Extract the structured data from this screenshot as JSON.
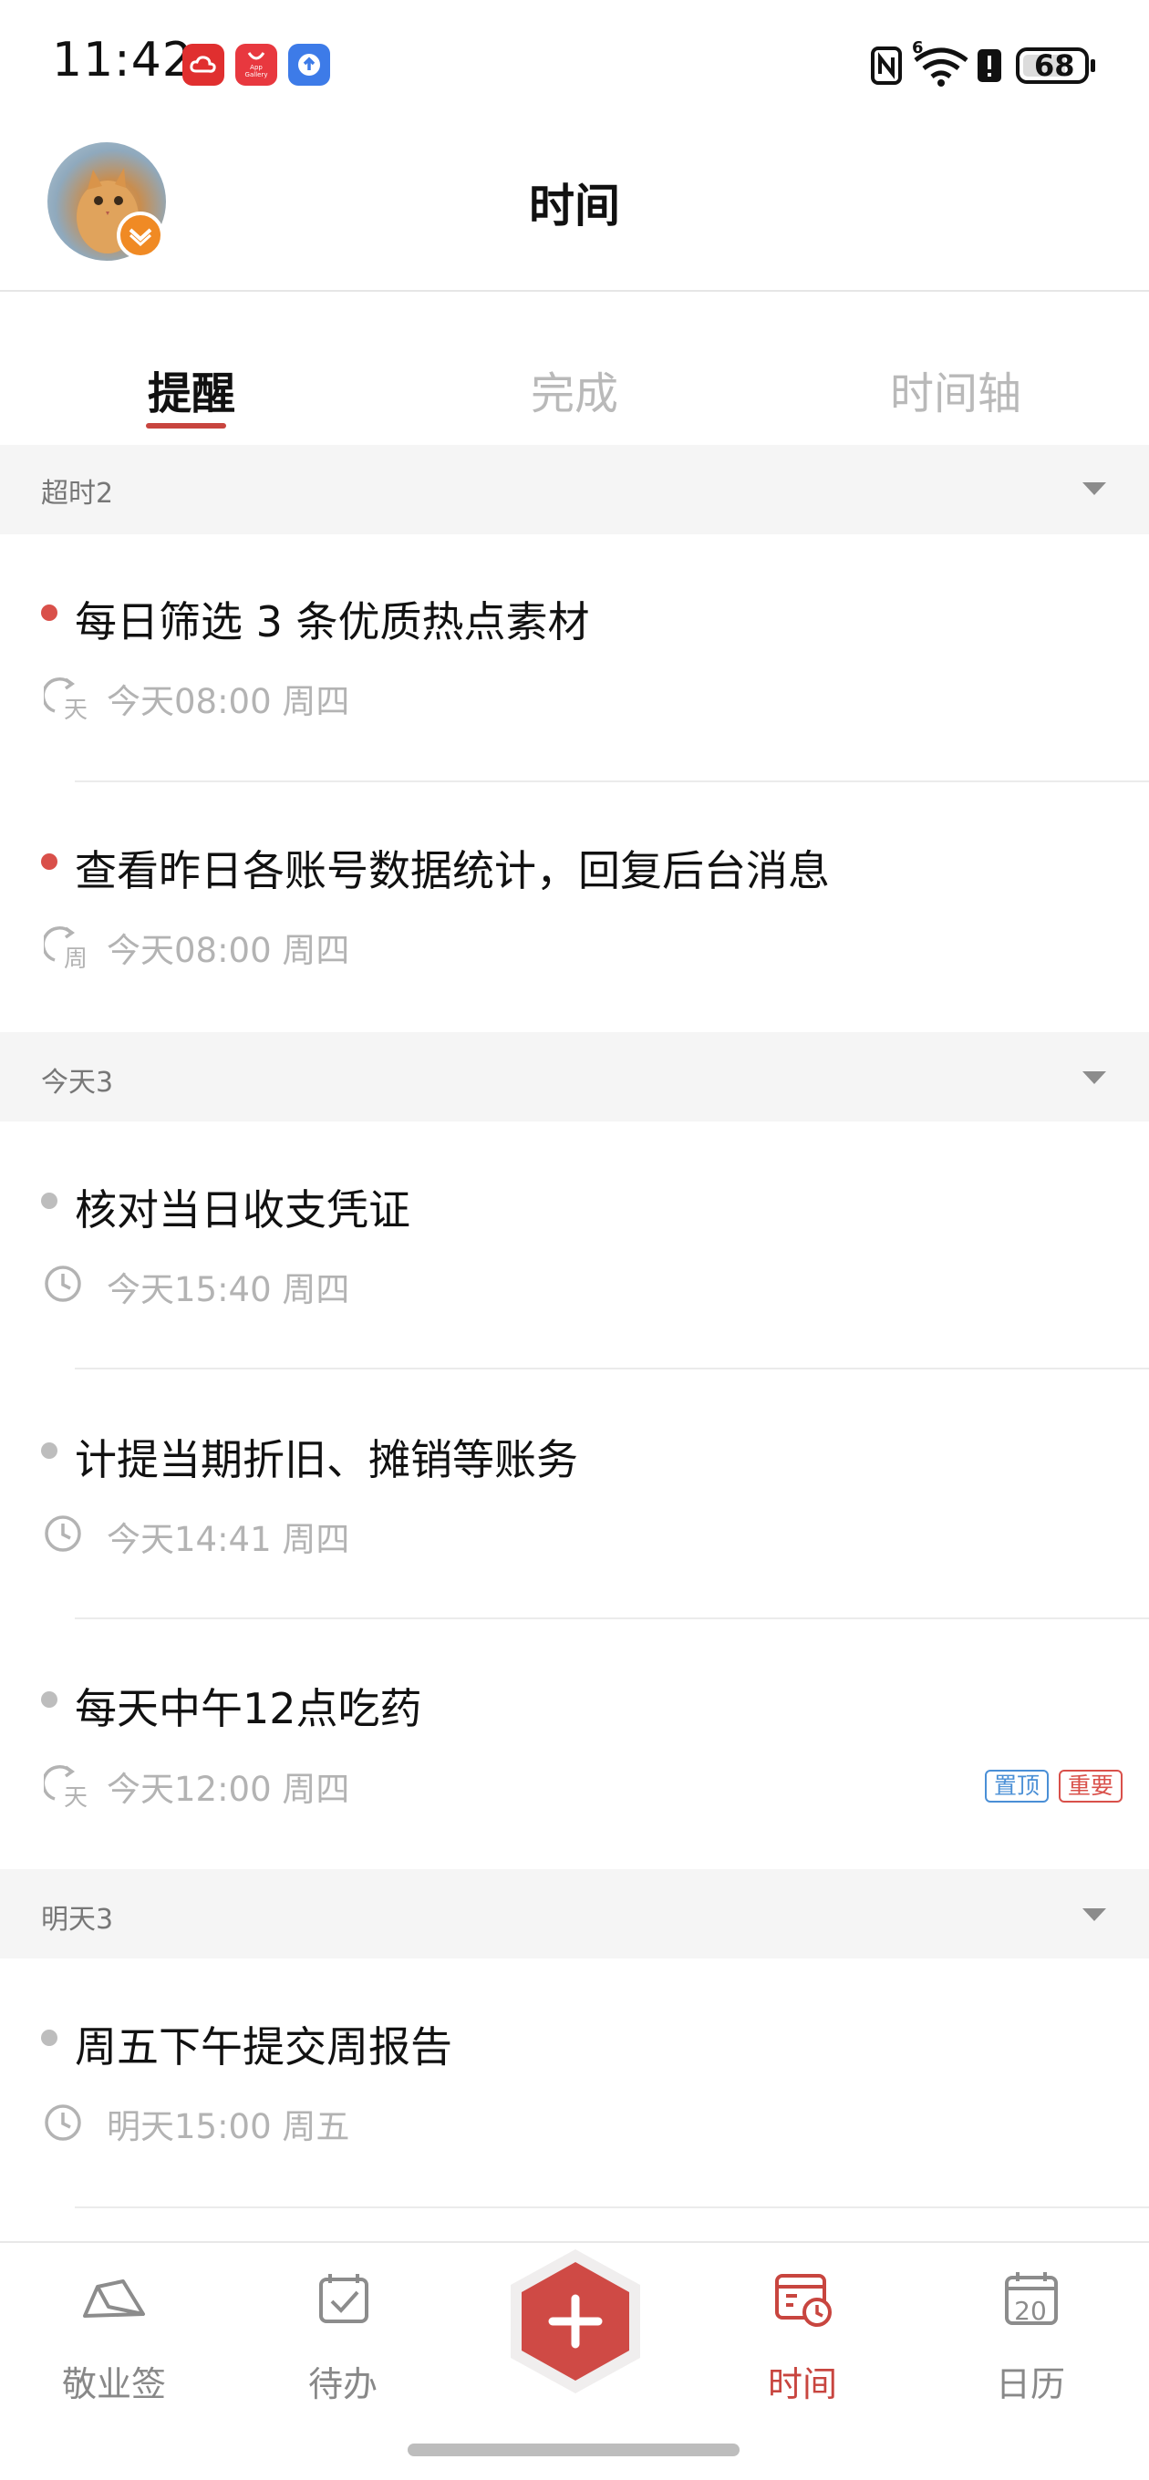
{
  "status_bar": {
    "time": "11:42",
    "app_icons": [
      "cloud-app-icon",
      "app-gallery-icon",
      "upload-app-icon"
    ],
    "app_gallery_label": "App Gallery",
    "system_icons": [
      "nfc-icon",
      "wifi-icon",
      "alert-icon",
      "battery-icon"
    ],
    "wifi_generation": "6",
    "battery_level": "68"
  },
  "header": {
    "title": "时间"
  },
  "tabs": [
    {
      "label": "提醒",
      "active": true
    },
    {
      "label": "完成",
      "active": false
    },
    {
      "label": "时间轴",
      "active": false
    }
  ],
  "sections": [
    {
      "label": "超时2",
      "items": [
        {
          "title": "每日筛选 3 条优质热点素材",
          "meta": "今天08:00 周四",
          "icon": "repeat-daily-icon",
          "icon_text": "天",
          "dot": "red"
        },
        {
          "title": "查看昨日各账号数据统计，回复后台消息",
          "meta": "今天08:00 周四",
          "icon": "repeat-weekly-icon",
          "icon_text": "周",
          "dot": "red"
        }
      ]
    },
    {
      "label": "今天3",
      "items": [
        {
          "title": "核对当日收支凭证",
          "meta": "今天15:40 周四",
          "icon": "clock-icon",
          "dot": "gray"
        },
        {
          "title": "计提当期折旧、摊销等账务",
          "meta": "今天14:41 周四",
          "icon": "clock-icon",
          "dot": "gray"
        },
        {
          "title": "每天中午12点吃药",
          "meta": "今天12:00 周四",
          "icon": "repeat-daily-icon",
          "icon_text": "天",
          "dot": "gray",
          "tags": [
            "置顶",
            "重要"
          ]
        }
      ]
    },
    {
      "label": "明天3",
      "items": [
        {
          "title": "周五下午提交周报告",
          "meta": "明天15:00 周五",
          "icon": "clock-icon",
          "dot": "gray"
        }
      ]
    }
  ],
  "bottom_nav": [
    {
      "label": "敬业签",
      "icon": "memo-note-icon",
      "active": false
    },
    {
      "label": "待办",
      "icon": "todo-check-icon",
      "active": false
    },
    {
      "label": "",
      "icon": "plus-icon",
      "active": false
    },
    {
      "label": "时间",
      "icon": "calendar-clock-icon",
      "active": true
    },
    {
      "label": "日历",
      "icon": "calendar-icon",
      "active": false,
      "icon_text": "20"
    }
  ],
  "colors": {
    "accent": "#c8453f",
    "overdue_dot": "#d9504a",
    "normal_dot": "#bdbdbd",
    "muted_text": "#b3b3b3",
    "section_bg": "#f5f5f5"
  }
}
